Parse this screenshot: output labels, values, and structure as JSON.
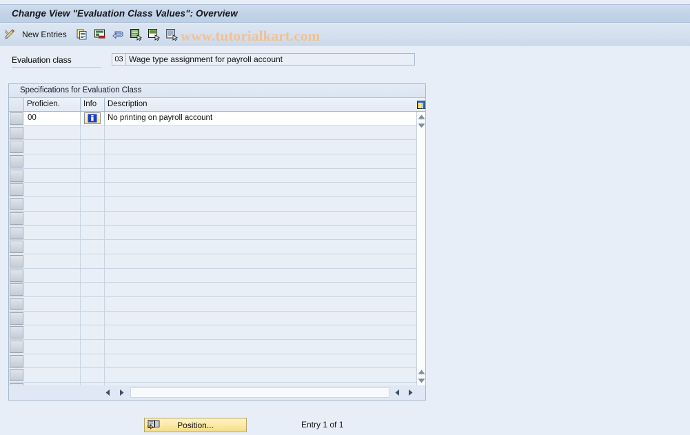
{
  "window": {
    "title": "Change View \"Evaluation Class Values\": Overview"
  },
  "toolbar": {
    "edit_icon": "pencil-icon",
    "new_entries_label": "New Entries",
    "buttons": [
      {
        "name": "copy-icon",
        "title": "Copy As..."
      },
      {
        "name": "delete-icon",
        "title": "Delete"
      },
      {
        "name": "undo-icon",
        "title": "Undo Change"
      },
      {
        "name": "select-all-icon",
        "title": "Select All"
      },
      {
        "name": "deselect-all-icon",
        "title": "Deselect All"
      },
      {
        "name": "details-icon",
        "title": "Details"
      }
    ],
    "watermark": "www.tutorialkart.com"
  },
  "eval_class": {
    "label": "Evaluation class",
    "key": "03",
    "description": "Wage type assignment for payroll account"
  },
  "panel": {
    "title": "Specifications for Evaluation Class",
    "columns": [
      "",
      "Proficien.",
      "Info",
      "Description"
    ],
    "config_icon": "table-settings-icon",
    "rows": [
      {
        "proficiency": "00",
        "info": "info-icon",
        "description": "No printing on payroll account"
      }
    ],
    "empty_row_count": 19
  },
  "scrollbars": {
    "v_up_icon": "scroll-up-icon",
    "v_down_icon": "scroll-down-icon",
    "h_left_icon": "scroll-left-icon",
    "h_right_icon": "scroll-right-icon"
  },
  "footer": {
    "position_button": "Position...",
    "position_icon": "position-icon",
    "entry_status": "Entry 1 of 1"
  },
  "colors": {
    "page_background": "#e8eef7",
    "title_bar": "#c3d3e8",
    "watermark": "#f0c193",
    "button_yellow": "#fbe9a6",
    "grid_line": "#c8d4e2"
  }
}
